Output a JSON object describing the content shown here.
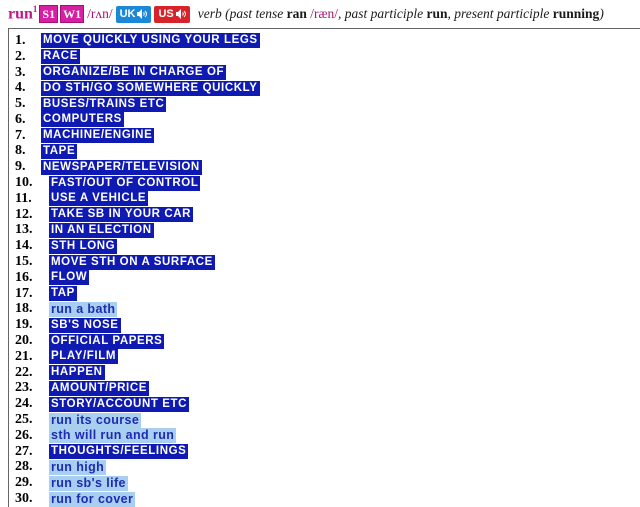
{
  "header": {
    "headword": "run",
    "homonym": "1",
    "freq_spoken": "S1",
    "freq_written": "W1",
    "pronunciation": "/rʌn/",
    "audio_uk": "UK",
    "audio_us": "US",
    "pos": "verb",
    "grammar": {
      "open": "(past tense ",
      "past": "ran",
      "past_pron": " /ræn/",
      "mid": ", past participle ",
      "pp": "run",
      "mid2": ", present participle ",
      "presp": "running",
      "close": ")"
    }
  },
  "senses": [
    {
      "n": "1.",
      "label": "MOVE QUICKLY USING YOUR LEGS",
      "style": "caps"
    },
    {
      "n": "2.",
      "label": "RACE",
      "style": "caps"
    },
    {
      "n": "3.",
      "label": "ORGANIZE/BE IN CHARGE OF",
      "style": "caps"
    },
    {
      "n": "4.",
      "label": "DO STH/GO SOMEWHERE QUICKLY",
      "style": "caps"
    },
    {
      "n": "5.",
      "label": "BUSES/TRAINS ETC",
      "style": "caps"
    },
    {
      "n": "6.",
      "label": "COMPUTERS",
      "style": "caps"
    },
    {
      "n": "7.",
      "label": "MACHINE/ENGINE",
      "style": "caps"
    },
    {
      "n": "8.",
      "label": "TAPE",
      "style": "caps"
    },
    {
      "n": "9.",
      "label": "NEWSPAPER/TELEVISION",
      "style": "caps"
    },
    {
      "n": "10.",
      "label": "FAST/OUT OF CONTROL",
      "style": "caps"
    },
    {
      "n": "11.",
      "label": "USE A VEHICLE",
      "style": "caps"
    },
    {
      "n": "12.",
      "label": "TAKE SB IN YOUR CAR",
      "style": "caps"
    },
    {
      "n": "13.",
      "label": "IN AN ELECTION",
      "style": "caps"
    },
    {
      "n": "14.",
      "label": "STH LONG",
      "style": "caps"
    },
    {
      "n": "15.",
      "label": "MOVE STH ON A SURFACE",
      "style": "caps"
    },
    {
      "n": "16.",
      "label": "FLOW",
      "style": "caps"
    },
    {
      "n": "17.",
      "label": "TAP",
      "style": "caps"
    },
    {
      "n": "18.",
      "label": "run a bath",
      "style": "phr"
    },
    {
      "n": "19.",
      "label": "SB'S NOSE",
      "style": "caps"
    },
    {
      "n": "20.",
      "label": "OFFICIAL PAPERS",
      "style": "caps"
    },
    {
      "n": "21.",
      "label": "PLAY/FILM",
      "style": "caps"
    },
    {
      "n": "22.",
      "label": "HAPPEN",
      "style": "caps"
    },
    {
      "n": "23.",
      "label": "AMOUNT/PRICE",
      "style": "caps"
    },
    {
      "n": "24.",
      "label": "STORY/ACCOUNT ETC",
      "style": "caps"
    },
    {
      "n": "25.",
      "label": "run its course",
      "style": "phr"
    },
    {
      "n": "26.",
      "label": "sth will run and run",
      "style": "phr"
    },
    {
      "n": "27.",
      "label": "THOUGHTS/FEELINGS",
      "style": "caps"
    },
    {
      "n": "28.",
      "label": "run high",
      "style": "phr"
    },
    {
      "n": "29.",
      "label": "run sb's life",
      "style": "phr"
    },
    {
      "n": "30.",
      "label": "run for cover",
      "style": "phr"
    }
  ],
  "colors": {
    "caps_bg": "#0f1ab2",
    "phrase_bg": "#a9cff0",
    "headword": "#c0168e"
  }
}
